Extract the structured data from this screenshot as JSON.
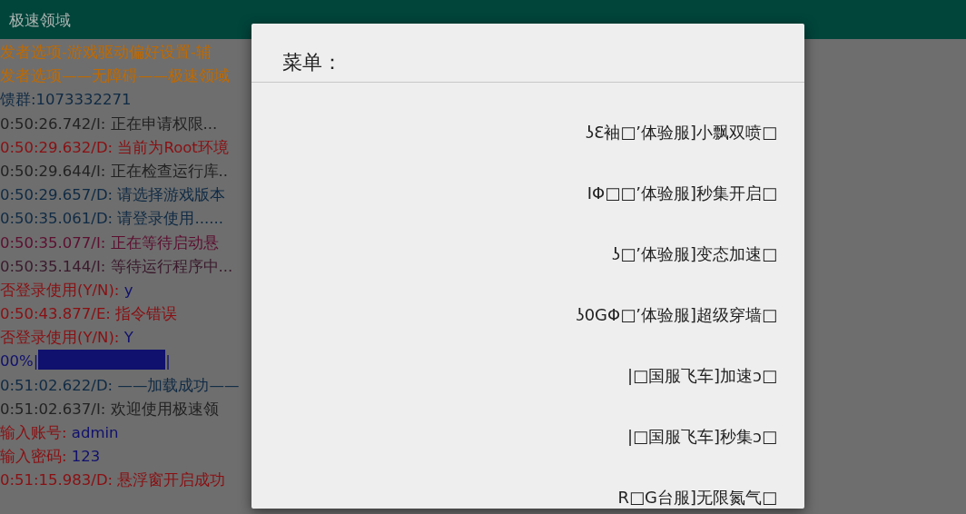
{
  "app_bar": {
    "title": "极速领域"
  },
  "log": [
    {
      "segments": [
        {
          "text": "发者选项-游戏驱动偏好设置-辅",
          "color": "#c06a00"
        }
      ]
    },
    {
      "segments": [
        {
          "text": "发者选项——无障碍——极速领域",
          "color": "#c06a00"
        }
      ]
    },
    {
      "segments": [
        {
          "text": "馈群:1073332271",
          "color": "#0f2a44"
        }
      ]
    },
    {
      "segments": [
        {
          "text": "0:50:26.742/I: 正在申请权限...",
          "color": "#222222"
        }
      ]
    },
    {
      "segments": [
        {
          "text": "0:50:29.632/D: 当前为Root环境",
          "color": "#8a0f12"
        }
      ]
    },
    {
      "segments": [
        {
          "text": "0:50:29.644/I: 正在检查运行库..",
          "color": "#222222"
        }
      ]
    },
    {
      "segments": [
        {
          "text": "0:50:29.657/D: 请选择游戏版本",
          "color": "#0f2a44"
        }
      ]
    },
    {
      "segments": [
        {
          "text": "0:50:35.061/D: 请登录使用......",
          "color": "#0f2a44"
        }
      ]
    },
    {
      "segments": [
        {
          "text": "0:50:35.077/I: 正在等待启动悬",
          "color": "#5c0f30"
        }
      ]
    },
    {
      "segments": [
        {
          "text": "0:50:35.144/I: 等待运行程序中...",
          "color": "#3a1a2c"
        }
      ]
    },
    {
      "segments": [
        {
          "text": "否登录使用(Y/N): ",
          "color": "#8a0f12"
        },
        {
          "text": "y",
          "color": "#10106e"
        }
      ]
    },
    {
      "segments": [
        {
          "text": "0:50:43.877/E: 指令错误",
          "color": "#8a0f12"
        }
      ]
    },
    {
      "segments": [
        {
          "text": "否登录使用(Y/N): ",
          "color": "#8a0f12"
        },
        {
          "text": "Y",
          "color": "#10106e"
        }
      ]
    },
    {
      "kind": "progress",
      "label": "00%|",
      "end": "|",
      "level": 1,
      "color": "#10106e"
    },
    {
      "segments": [
        {
          "text": "0:51:02.622/D: ——加载成功——",
          "color": "#0f2a44"
        }
      ]
    },
    {
      "segments": [
        {
          "text": "0:51:02.637/I: 欢迎使用极速领",
          "color": "#222222"
        }
      ]
    },
    {
      "segments": [
        {
          "text": "输入账号: ",
          "color": "#8a0f12"
        },
        {
          "text": "admin",
          "color": "#10106e"
        }
      ]
    },
    {
      "segments": [
        {
          "text": "输入密码: ",
          "color": "#8a0f12"
        },
        {
          "text": "123",
          "color": "#10106e"
        }
      ]
    },
    {
      "segments": [
        {
          "text": "0:51:15.983/D: 悬浮窗开启成功",
          "color": "#8a0f12"
        }
      ]
    }
  ],
  "dialog": {
    "title": "菜单：",
    "items": [
      "ʖƐ袖□’体验服]小飘双喷□",
      "IΦ□□’体验服]秒集开启□",
      "ʖ□’体验服]变态加速□",
      "ʖ0GΦ□’体验服]超级穿墙□",
      "|□国服飞车]加速ɔ□",
      "|□国服飞车]秒集ɔ□",
      "R□G台服]无限氮气□"
    ]
  }
}
